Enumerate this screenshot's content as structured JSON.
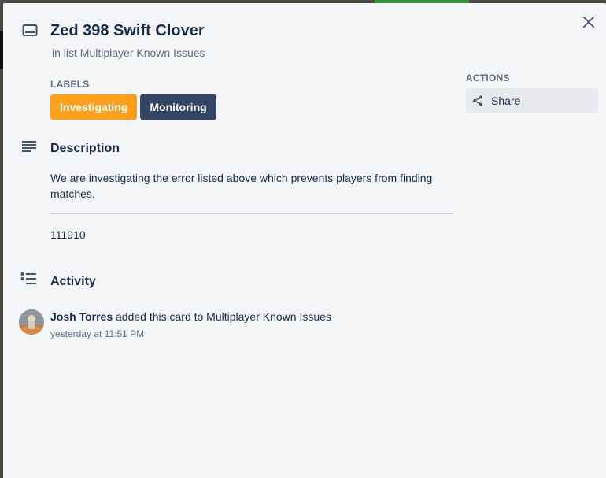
{
  "card": {
    "title": "Zed 398 Swift Clover",
    "in_list_prefix": "in list",
    "list_name": "Multiplayer Known Issues"
  },
  "labels": {
    "heading": "LABELS",
    "items": [
      {
        "text": "Investigating",
        "color": "#ff9f1a"
      },
      {
        "text": "Monitoring",
        "color": "#344563"
      }
    ]
  },
  "description": {
    "heading": "Description",
    "text": "We are investigating the error listed above which prevents players from finding matches.",
    "number": "111910"
  },
  "activity": {
    "heading": "Activity",
    "entries": [
      {
        "member": "Josh Torres",
        "action": "added this card to Multiplayer Known Issues",
        "time": "yesterday at 11:51 PM"
      }
    ]
  },
  "actions": {
    "heading": "ACTIONS",
    "share_label": "Share"
  },
  "icons": {
    "close": "close-icon",
    "card": "card-icon",
    "description": "description-icon",
    "activity": "activity-icon",
    "share": "share-icon"
  },
  "colors": {
    "modal_bg": "#f4f5f7",
    "text_primary": "#172b4d",
    "text_secondary": "#5e6c84"
  }
}
